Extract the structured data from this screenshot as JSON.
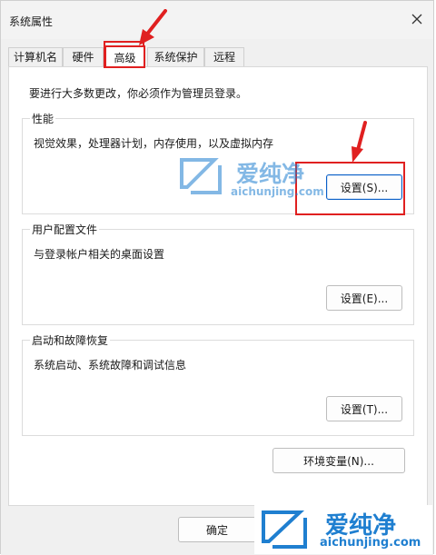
{
  "window": {
    "title": "系统属性"
  },
  "tabs": [
    {
      "label": "计算机名"
    },
    {
      "label": "硬件"
    },
    {
      "label": "高级"
    },
    {
      "label": "系统保护"
    },
    {
      "label": "远程"
    }
  ],
  "active_tab": "高级",
  "intro": "要进行大多数更改，你必须作为管理员登录。",
  "groups": {
    "performance": {
      "label": "性能",
      "desc": "视觉效果，处理器计划，内存使用，以及虚拟内存",
      "button": "设置(S)..."
    },
    "profile": {
      "label": "用户配置文件",
      "desc": "与登录帐户相关的桌面设置",
      "button": "设置(E)..."
    },
    "startup": {
      "label": "启动和故障恢复",
      "desc": "系统启动、系统故障和调试信息",
      "button": "设置(T)..."
    }
  },
  "env_button": "环境变量(N)...",
  "footer": {
    "ok": "确定"
  },
  "watermark": {
    "cn": "爱纯净",
    "url": "aichunjing.com"
  },
  "colors": {
    "highlight": "#e02020",
    "watermark": "#1f7fd0",
    "accent": "#0a5fc7"
  }
}
